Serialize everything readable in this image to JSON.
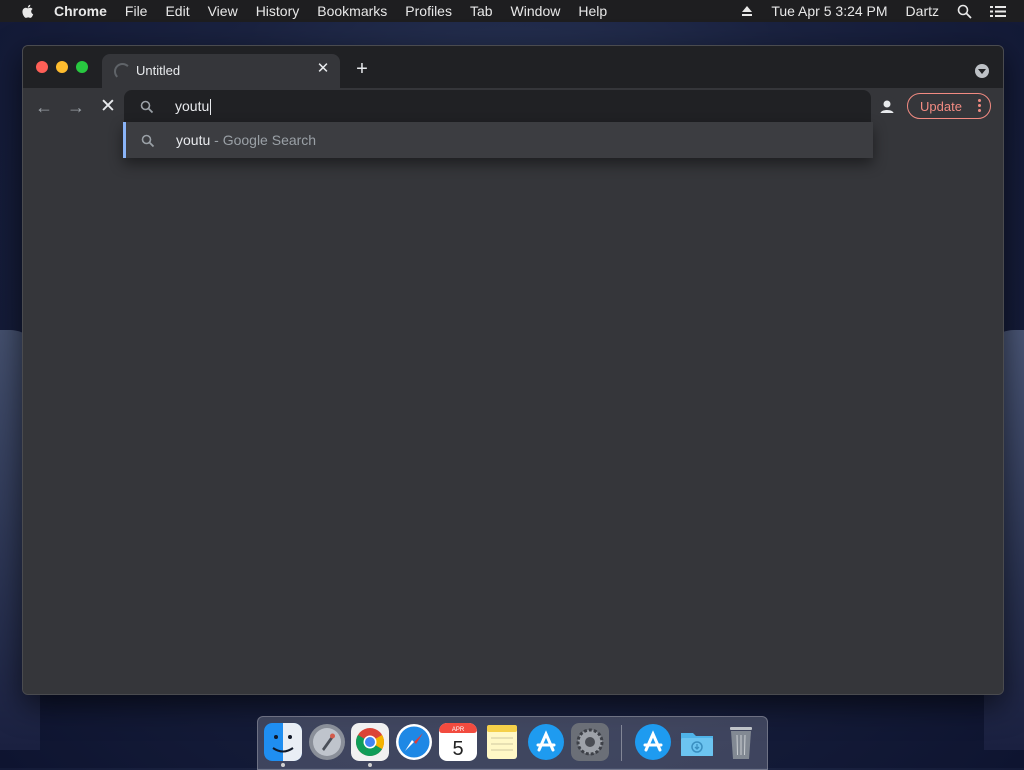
{
  "menubar": {
    "app_name": "Chrome",
    "items": [
      "File",
      "Edit",
      "View",
      "History",
      "Bookmarks",
      "Profiles",
      "Tab",
      "Window",
      "Help"
    ],
    "status": {
      "datetime": "Tue Apr 5  3:24 PM",
      "user": "Dartz"
    },
    "icons": [
      "apple-icon",
      "eject-icon",
      "spotlight-search-icon",
      "control-center-icon"
    ]
  },
  "browser": {
    "tab": {
      "title": "Untitled",
      "loading": true
    },
    "omnibox": {
      "value": "youtu"
    },
    "suggestion": {
      "query": "youtu",
      "suffix": " - Google Search"
    },
    "update_button": "Update"
  },
  "dock": {
    "apps": [
      {
        "name": "Finder",
        "icon": "finder-icon",
        "running": true
      },
      {
        "name": "Launchpad",
        "icon": "launchpad-icon",
        "running": false
      },
      {
        "name": "Google Chrome",
        "icon": "chrome-icon",
        "running": true
      },
      {
        "name": "Safari",
        "icon": "safari-icon",
        "running": false
      },
      {
        "name": "Calendar",
        "icon": "calendar-icon",
        "running": false,
        "month": "APR",
        "day": "5"
      },
      {
        "name": "Notes",
        "icon": "notes-icon",
        "running": false
      },
      {
        "name": "App Store",
        "icon": "app-store-icon",
        "running": false
      },
      {
        "name": "System Preferences",
        "icon": "system-preferences-icon",
        "running": false
      },
      {
        "name": "Applications",
        "icon": "applications-folder-icon",
        "running": false
      },
      {
        "name": "Downloads",
        "icon": "downloads-folder-icon",
        "running": false
      },
      {
        "name": "Trash",
        "icon": "trash-icon",
        "running": false
      }
    ]
  },
  "colors": {
    "accent_blue": "#8ab4f8",
    "update_red": "#f28b82",
    "window_bg": "#35363a",
    "omnibox_bg": "#202124"
  }
}
